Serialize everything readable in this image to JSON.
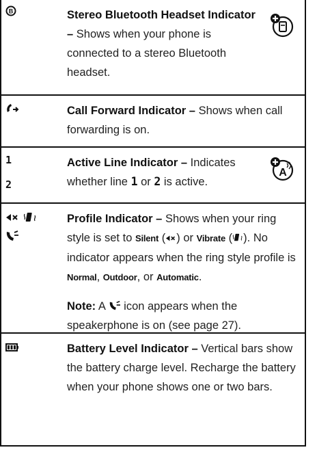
{
  "rows": [
    {
      "title": "Stereo Bluetooth Headset Indicator –",
      "desc": "Shows when your phone is connected to a stereo Bluetooth headset.",
      "icon": "bluetooth-headset-icon",
      "badge": "phone-feature-icon"
    },
    {
      "title": "Call Forward Indicator –",
      "desc": "Shows when call forwarding is on.",
      "icon": "call-forward-icon"
    },
    {
      "title": "Active Line Indicator –",
      "desc_a": "Indicates whether line",
      "line1": "1",
      "desc_b": "or",
      "line2": "2",
      "desc_c": "is active.",
      "icon_labels": [
        "1",
        "2"
      ],
      "badge": "network-feature-icon"
    },
    {
      "title": "Profile Indicator –",
      "desc_a": "Shows when your ring style is set to",
      "silent": "Silent",
      "desc_b": "or",
      "vibrate": "Vibrate",
      "desc_c": ". No indicator appears when the ring style profile is",
      "normal": "Normal",
      "outdoor": "Outdoor",
      "or": "or",
      "automatic": "Automatic",
      "note_label": "Note:",
      "note_a": "A",
      "note_b": "icon appears when the speakerphone is on (see page 27).",
      "icons": [
        "silent-icon",
        "vibrate-icon",
        "speakerphone-icon"
      ]
    },
    {
      "title": "Battery Level Indicator –",
      "desc": "Vertical bars show the battery charge level. Recharge the battery when your phone shows one or two bars.",
      "icon": "battery-icon"
    }
  ]
}
